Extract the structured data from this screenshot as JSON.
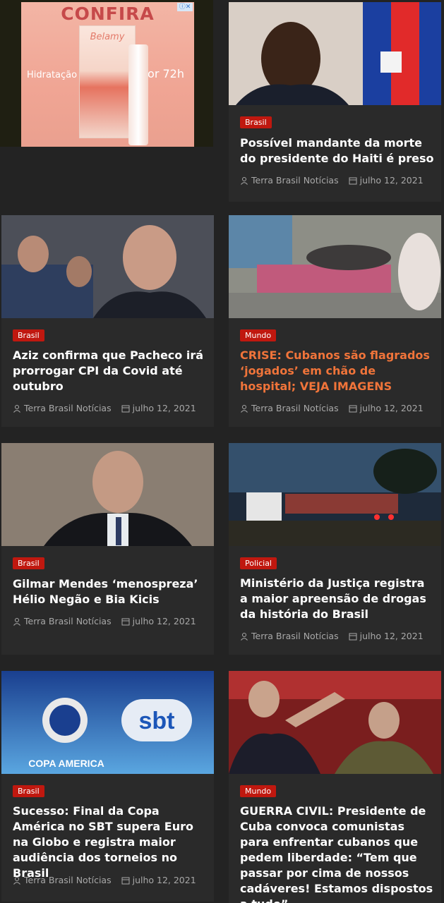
{
  "ad": {
    "headline": "CONFIRA",
    "left_text": "Hidratação",
    "right_text": "por 72h",
    "brand": "Belamy",
    "corner": "ⓘ✕"
  },
  "meta_icons": [
    "user-icon",
    "calendar-icon"
  ],
  "colors": {
    "category_bg": "#c0180f",
    "highlight_title": "#f0743a",
    "background": "#232323"
  },
  "articles": [
    {
      "category": "Brasil",
      "title": "Possível mandante da morte do presidente do Haiti é preso",
      "author": "Terra Brasil Notícias",
      "date": "julho 12, 2021"
    },
    {
      "category": "Brasil",
      "title": "Aziz confirma que Pacheco irá prorrogar CPI da Covid até outubro",
      "author": "Terra Brasil Notícias",
      "date": "julho 12, 2021"
    },
    {
      "category": "Mundo",
      "title": "CRISE: Cubanos são flagrados ‘jogados’ em chão de hospital; VEJA IMAGENS",
      "author": "Terra Brasil Notícias",
      "date": "julho 12, 2021"
    },
    {
      "category": "Brasil",
      "title": "Gilmar Mendes ‘menospreza’ Hélio Negão e Bia Kicis",
      "author": "Terra Brasil Notícias",
      "date": "julho 12, 2021"
    },
    {
      "category": "Policial",
      "title": "Ministério da Justiça registra a maior apreensão de drogas da história do Brasil",
      "author": "Terra Brasil Notícias",
      "date": "julho 12, 2021"
    },
    {
      "category": "Brasil",
      "title": "Sucesso: Final da Copa América no SBT supera Euro na Globo e registra maior audiência dos torneios no Brasil",
      "author": "Terra Brasil Notícias",
      "date": "julho 12, 2021"
    },
    {
      "category": "Mundo",
      "title": "GUERRA CIVIL: Presidente de Cuba convoca comunistas para enfrentar cubanos que pedem liberdade: “Tem que passar por cima de nossos cadáveres! Estamos dispostos a tudo”",
      "author": "",
      "date": ""
    }
  ],
  "image_texts": {
    "copa": "COPA AMERICA",
    "sbt": "sbt"
  }
}
